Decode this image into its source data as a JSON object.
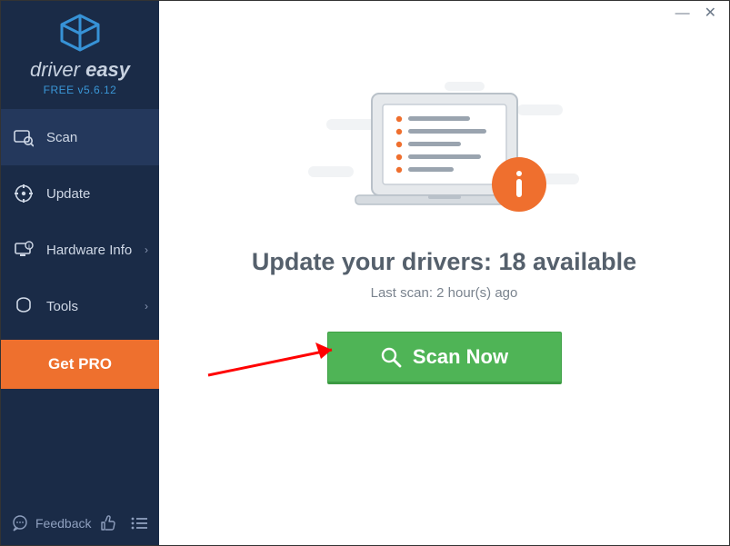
{
  "brand": {
    "name_prefix": "driver ",
    "name_bold": "easy",
    "version": "FREE v5.6.12"
  },
  "sidebar": {
    "items": [
      {
        "label": "Scan"
      },
      {
        "label": "Update"
      },
      {
        "label": "Hardware Info"
      },
      {
        "label": "Tools"
      }
    ],
    "getpro_label": "Get PRO",
    "feedback_label": "Feedback"
  },
  "main": {
    "headline_prefix": "Update your drivers: ",
    "available_count": "18",
    "headline_suffix": " available",
    "last_scan": "Last scan: 2 hour(s) ago",
    "scan_button": "Scan Now"
  },
  "colors": {
    "sidebar_bg": "#1a2b47",
    "accent_orange": "#ee702e",
    "accent_green": "#4fb456",
    "brand_blue": "#3792d6"
  }
}
